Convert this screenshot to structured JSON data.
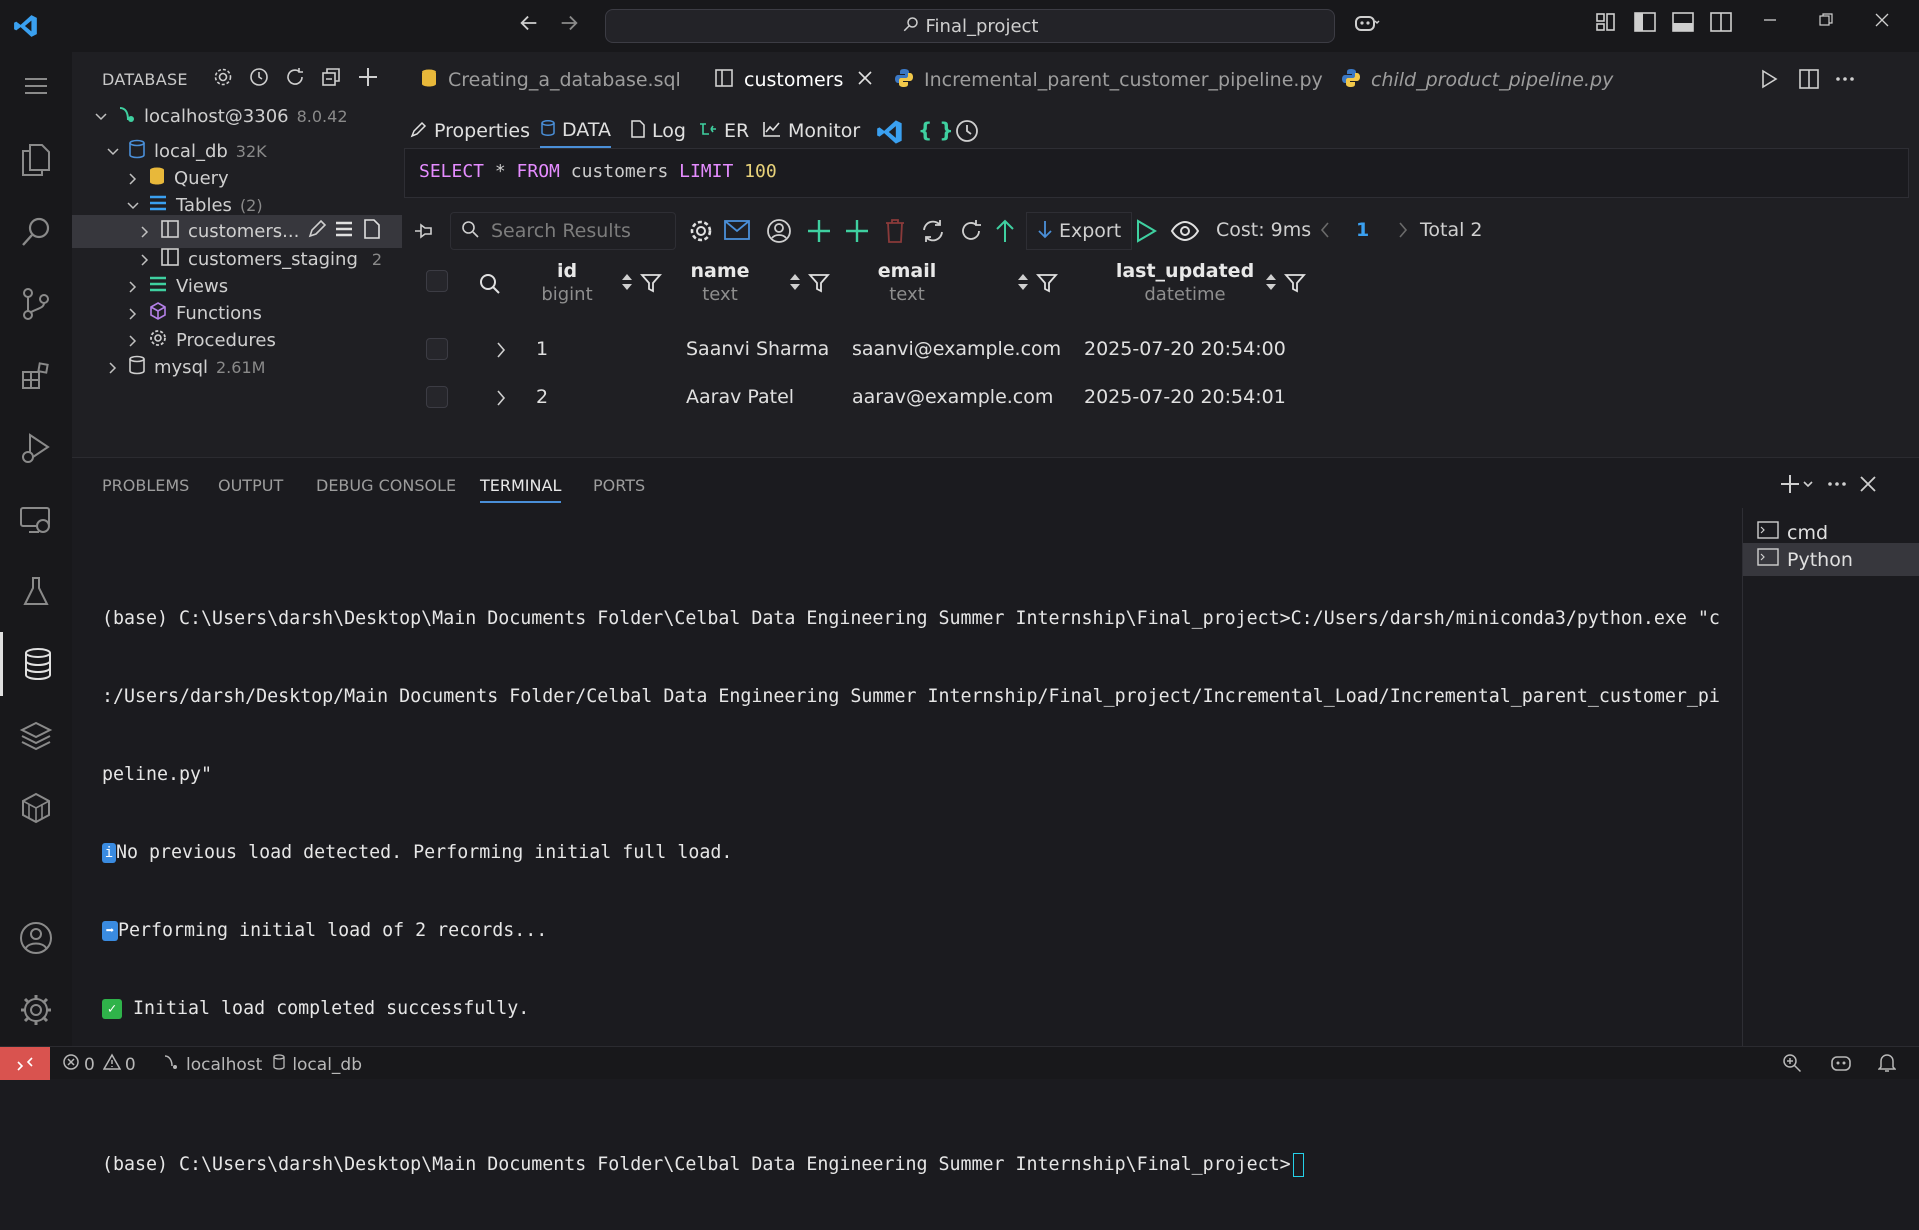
{
  "titlebar": {
    "search_text": "Final_project"
  },
  "sidebar": {
    "title": "DATABASE",
    "tree": {
      "connection": {
        "label": "localhost@3306",
        "version": "8.0.42"
      },
      "local_db": {
        "label": "local_db",
        "size": "32K"
      },
      "query": "Query",
      "tables": {
        "label": "Tables",
        "count": "(2)"
      },
      "customers": "customers...",
      "customers_staging": {
        "label": "customers_staging",
        "count": "2"
      },
      "views": "Views",
      "functions": "Functions",
      "procedures": "Procedures",
      "mysql": {
        "label": "mysql",
        "size": "2.61M"
      }
    }
  },
  "tabs": [
    {
      "label": "Creating_a_database.sql"
    },
    {
      "label": "customers"
    },
    {
      "label": "Incremental_parent_customer_pipeline.py"
    },
    {
      "label": "child_product_pipeline.py"
    }
  ],
  "editor_toolbar": {
    "properties": "Properties",
    "data": "DATA",
    "log": "Log",
    "er": "ER",
    "monitor": "Monitor",
    "braces": "{ }"
  },
  "sql": {
    "kw1": "SELECT",
    "star": " * ",
    "kw2": "FROM",
    "table": " customers ",
    "kw3": "LIMIT",
    "limit": " 100"
  },
  "result_toolbar": {
    "search_placeholder": "Search Results",
    "export": "Export",
    "cost": "Cost: 9ms",
    "page": "1",
    "total": "Total 2"
  },
  "grid": {
    "columns": [
      {
        "name": "id",
        "type": "bigint"
      },
      {
        "name": "name",
        "type": "text"
      },
      {
        "name": "email",
        "type": "text"
      },
      {
        "name": "last_updated",
        "type": "datetime"
      }
    ],
    "rows": [
      {
        "id": "1",
        "name": "Saanvi Sharma",
        "email": "saanvi@example.com",
        "last_updated": "2025-07-20 20:54:00"
      },
      {
        "id": "2",
        "name": "Aarav Patel",
        "email": "aarav@example.com",
        "last_updated": "2025-07-20 20:54:01"
      }
    ]
  },
  "panel": {
    "tabs": [
      "PROBLEMS",
      "OUTPUT",
      "DEBUG CONSOLE",
      "TERMINAL",
      "PORTS"
    ],
    "terminal_lines": [
      "(base) C:\\Users\\darsh\\Desktop\\Main Documents Folder\\Celbal Data Engineering Summer Internship\\Final_project>C:/Users/darsh/miniconda3/python.exe \"c",
      ":/Users/darsh/Desktop/Main Documents Folder/Celbal Data Engineering Summer Internship/Final_project/Incremental_Load/Incremental_parent_customer_pi",
      "peline.py\"",
      "No previous load detected. Performing initial full load.",
      "Performing initial load of 2 records...",
      " Initial load completed successfully.",
      "(base) C:\\Users\\darsh\\Desktop\\Main Documents Folder\\Celbal Data Engineering Summer Internship\\Final_project>"
    ],
    "terminals": [
      "cmd",
      "Python"
    ]
  },
  "status": {
    "errors": "0",
    "warnings": "0",
    "host": "localhost",
    "db": "local_db"
  },
  "colors": {
    "accent_blue": "#4a8fd8",
    "keyword": "#e58cff",
    "number": "#e8d27a",
    "remote": "#d9534f",
    "add_green": "#3fd0a0"
  }
}
